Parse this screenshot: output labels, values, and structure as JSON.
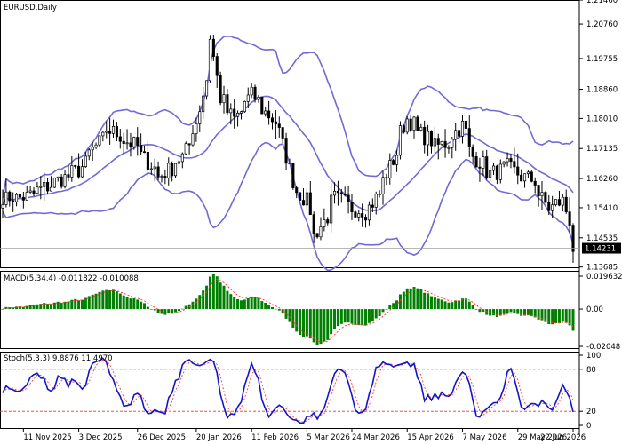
{
  "window": {
    "title": "EURUSD,Daily"
  },
  "colors": {
    "candle": "#000000",
    "bollinger": "#6f6ad6",
    "macd_hist": "#008000",
    "macd_signal": "#ff3b3b",
    "stoch_main": "#1414c8",
    "stoch_signal": "#ff3b3b",
    "level_line": "#e83b3b",
    "grid": "#c8c8c8",
    "price_marker_bg": "#000000",
    "price_marker_text": "#ffffff"
  },
  "icons": {
    "price_marker": "current-price-label"
  },
  "price_panel": {
    "current_price": "1.14231",
    "y_ticks": [
      "1.21460",
      "1.20760",
      "1.19755",
      "1.18860",
      "1.18010",
      "1.17135",
      "1.16260",
      "1.15410",
      "1.14535",
      "1.13685"
    ]
  },
  "macd_panel": {
    "label": "MACD(5,34,4) -0.011822 -0.010088",
    "y_ticks": [
      "0.019632",
      "0.00",
      "-0.02048"
    ]
  },
  "stoch_panel": {
    "label": "Stoch(5,3,3) 9.8876 11.4970",
    "y_ticks": [
      "100",
      "80",
      "20",
      "0"
    ],
    "levels": [
      80,
      20
    ]
  },
  "x_axis": {
    "labels": [
      "11 Nov 2025",
      "3 Dec 2025",
      "26 Dec 2025",
      "20 Jan 2026",
      "11 Feb 2026",
      "5 Mar 2026",
      "24 Mar 2026",
      "15 Apr 2026",
      "7 May 2026",
      "29 May 2026",
      "22 Jun 2026"
    ]
  },
  "chart_data": {
    "type": "candlestick",
    "symbol": "EURUSD",
    "timeframe": "Daily",
    "close_anchors": [
      [
        "11 Nov 2025",
        1.157
      ],
      [
        "3 Dec 2025",
        1.165
      ],
      [
        "15 Dec 2025",
        1.177
      ],
      [
        "26 Dec 2025",
        1.172
      ],
      [
        "5 Jan 2026",
        1.163
      ],
      [
        "14 Jan 2026",
        1.169
      ],
      [
        "20 Jan 2026",
        1.179
      ],
      [
        "26 Jan 2026",
        1.204
      ],
      [
        "29 Jan 2026",
        1.186
      ],
      [
        "4 Feb 2026",
        1.18
      ],
      [
        "11 Feb 2026",
        1.187
      ],
      [
        "18 Feb 2026",
        1.181
      ],
      [
        "23 Feb 2026",
        1.176
      ],
      [
        "27 Feb 2026",
        1.162
      ],
      [
        "5 Mar 2026",
        1.156
      ],
      [
        "9 Mar 2026",
        1.146
      ],
      [
        "17 Mar 2026",
        1.157
      ],
      [
        "24 Mar 2026",
        1.154
      ],
      [
        "30 Mar 2026",
        1.153
      ],
      [
        "6 Apr 2026",
        1.162
      ],
      [
        "15 Apr 2026",
        1.18
      ],
      [
        "20 Apr 2026",
        1.176
      ],
      [
        "27 Apr 2026",
        1.172
      ],
      [
        "1 May 2026",
        1.173
      ],
      [
        "7 May 2026",
        1.178
      ],
      [
        "12 May 2026",
        1.169
      ],
      [
        "19 May 2026",
        1.164
      ],
      [
        "26 May 2026",
        1.166
      ],
      [
        "29 May 2026",
        1.164
      ],
      [
        "5 Jun 2026",
        1.162
      ],
      [
        "11 Jun 2026",
        1.154
      ],
      [
        "17 Jun 2026",
        1.156
      ],
      [
        "22 Jun 2026",
        1.1423
      ]
    ],
    "bollinger": "on",
    "macd_params": [
      5,
      34,
      4
    ],
    "stoch_params": [
      5,
      3,
      3
    ],
    "price_range": [
      1.1365,
      1.2146
    ],
    "macd_range": [
      -0.02048,
      0.019632
    ],
    "stoch_range": [
      0,
      100
    ],
    "grid": "off"
  }
}
